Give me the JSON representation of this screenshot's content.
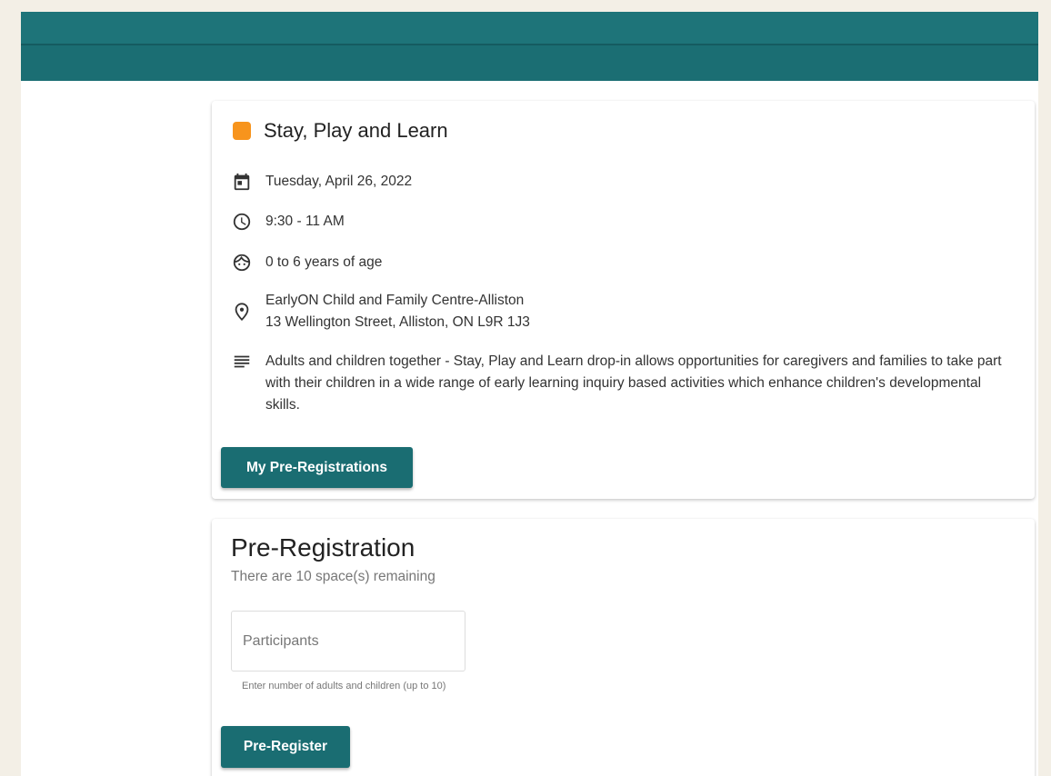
{
  "event": {
    "title": "Stay, Play and Learn",
    "color": "#f7941d",
    "date": "Tuesday, April 26, 2022",
    "time": "9:30 - 11 AM",
    "ages": "0 to 6 years of age",
    "location_name": "EarlyON Child and Family Centre-Alliston",
    "location_address": "13 Wellington Street, Alliston, ON L9R 1J3",
    "description": "Adults and children together - Stay, Play and Learn drop-in allows opportunities for caregivers and families to take part with their children in a wide range of early learning inquiry based activities which enhance children's developmental skills.",
    "my_preregistrations_label": "My Pre-Registrations",
    "icons": {
      "date": "calendar-icon",
      "time": "clock-icon",
      "ages": "child-face-icon",
      "location": "location-pin-icon",
      "description": "description-lines-icon"
    }
  },
  "preregistration": {
    "title": "Pre-Registration",
    "remaining_text": "There are 10 space(s) remaining",
    "participants_placeholder": "Participants",
    "participants_value": "",
    "hint": "Enter number of adults and children (up to 10)",
    "submit_label": "Pre-Register"
  },
  "colors": {
    "header": "#1b6e73",
    "button": "#1a6d72",
    "background": "#f3efe6"
  }
}
